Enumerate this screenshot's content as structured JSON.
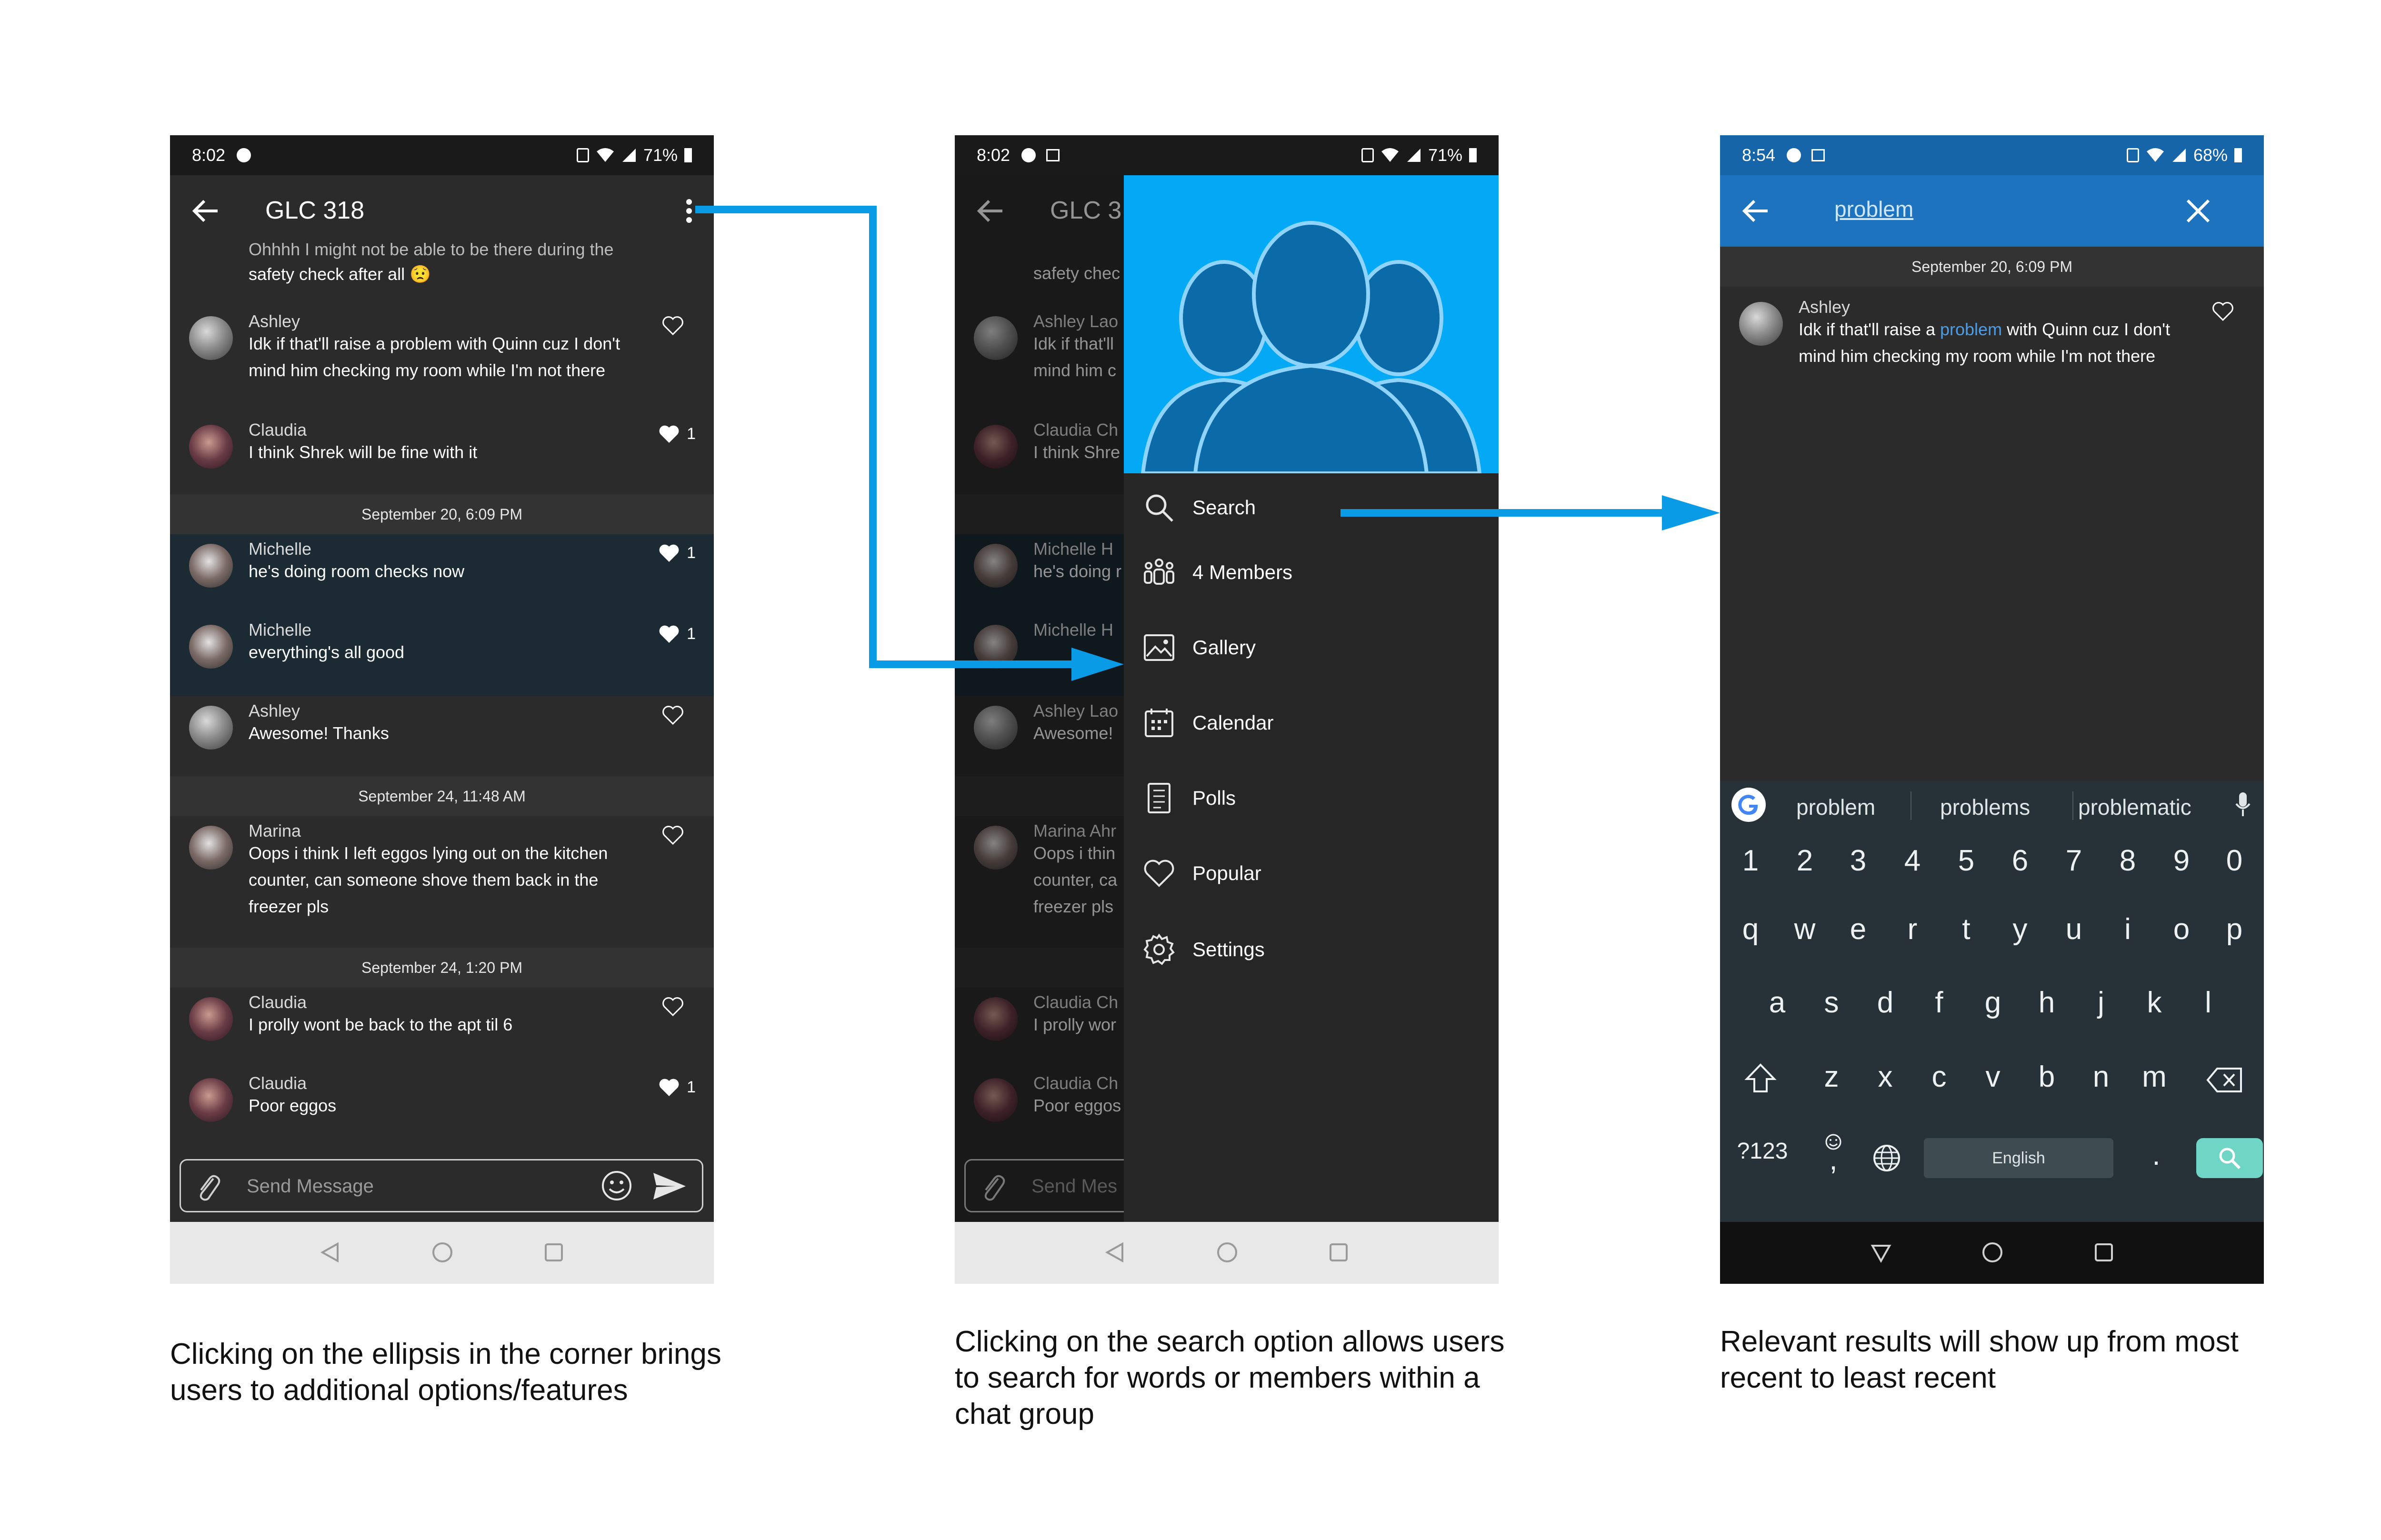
{
  "phone1": {
    "status": {
      "time": "8:02",
      "battery": "71%"
    },
    "title": "GLC 318",
    "partial_text_line1": "Ohhhh I might not be able to be there during the",
    "partial_text_line2": "safety check after all 😟",
    "messages": [
      {
        "name": "Ashley",
        "lines": [
          "Idk if that'll raise a problem with Quinn cuz I don't",
          "mind him checking my room while I'm not there"
        ],
        "likes": ""
      },
      {
        "name": "Claudia",
        "lines": [
          "I think Shrek will be fine with it"
        ],
        "likes": "1"
      },
      {
        "name": "Michelle",
        "lines": [
          "he's doing room checks now"
        ],
        "likes": "1"
      },
      {
        "name": "Michelle",
        "lines": [
          "everything's all good"
        ],
        "likes": "1"
      },
      {
        "name": "Ashley",
        "lines": [
          "Awesome! Thanks"
        ],
        "likes": ""
      },
      {
        "name": "Marina",
        "lines": [
          "Oops i think I left eggos lying out on the kitchen",
          "counter, can someone shove them back in the",
          "freezer pls"
        ],
        "likes": ""
      },
      {
        "name": "Claudia",
        "lines": [
          "I prolly wont be back to the apt til 6"
        ],
        "likes": ""
      },
      {
        "name": "Claudia",
        "lines": [
          "Poor eggos"
        ],
        "likes": "1"
      }
    ],
    "dates": [
      "September 20, 6:09 PM",
      "September 24, 11:48 AM",
      "September 24, 1:20 PM"
    ],
    "input_placeholder": "Send Message"
  },
  "phone2": {
    "status": {
      "time": "8:02",
      "battery": "71%"
    },
    "title_partial": "GLC 3",
    "bg_names": [
      "Ashley Lao",
      "Claudia Ch",
      "Michelle H",
      "Michelle H",
      "Ashley Lao",
      "Marina Ahr",
      "Claudia Ch",
      "Claudia Ch"
    ],
    "bg_lines": [
      "safety chec",
      "Idk if that'll",
      "mind him c",
      "I think Shre",
      "he's doing r",
      "Awesome!",
      "Oops i thin",
      "counter, ca",
      "freezer pls",
      "I prolly wor",
      "Poor eggos"
    ],
    "input_placeholder": "Send Mes",
    "menu": [
      "Search",
      "4 Members",
      "Gallery",
      "Calendar",
      "Polls",
      "Popular",
      "Settings"
    ]
  },
  "phone3": {
    "status": {
      "time": "8:54",
      "battery": "68%"
    },
    "query": "problem",
    "date": "September 20, 6:09 PM",
    "result": {
      "name": "Ashley",
      "before": "Idk if that'll raise a ",
      "match": "problem",
      "after": " with Quinn cuz I don't",
      "line2": "mind him checking my room while I'm not there"
    },
    "suggestions": [
      "problem",
      "problems",
      "problematic"
    ],
    "keys_numbers": [
      "1",
      "2",
      "3",
      "4",
      "5",
      "6",
      "7",
      "8",
      "9",
      "0"
    ],
    "keys_row1": [
      "q",
      "w",
      "e",
      "r",
      "t",
      "y",
      "u",
      "i",
      "o",
      "p"
    ],
    "keys_row2": [
      "a",
      "s",
      "d",
      "f",
      "g",
      "h",
      "j",
      "k",
      "l"
    ],
    "keys_row3": [
      "z",
      "x",
      "c",
      "v",
      "b",
      "n",
      "m"
    ],
    "sym_key": "?123",
    "space_label": "English",
    "comma": ",",
    "period": "."
  },
  "captions": [
    [
      "Clicking on the ellipsis in the corner brings",
      "users to additional options/features"
    ],
    [
      "Clicking on the search option allows users",
      "to search for words or members within a",
      "chat group"
    ],
    [
      "Relevant results will show up from most",
      "recent to least recent"
    ]
  ],
  "colors": {
    "accent": "#03a9f4",
    "search_bar": "#1e73be",
    "arrow": "#0a9be6",
    "keyboard": "#263238"
  }
}
